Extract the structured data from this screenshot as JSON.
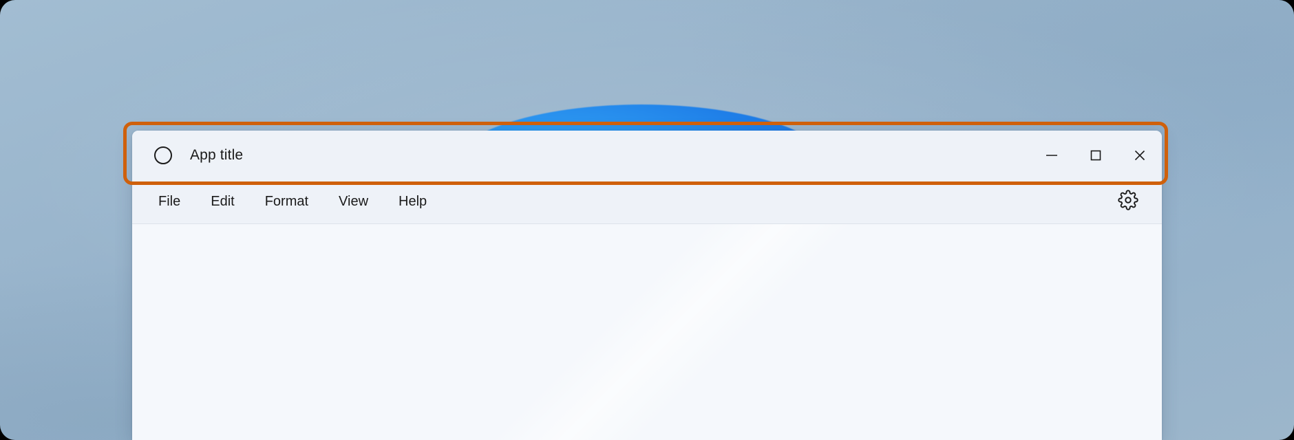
{
  "desktop": {
    "wallpaper_name": "windows-bloom-wallpaper",
    "background_color": "#97b3cb",
    "bloom_colors": [
      "#5fc4fb",
      "#35a7f6",
      "#1f7fe8",
      "#1a63d6"
    ]
  },
  "annotation": {
    "name": "title-bar-highlight",
    "color": "#cf600b",
    "target": "titlebar"
  },
  "window": {
    "titlebar": {
      "app_icon": "circle-icon",
      "title": "App title",
      "controls": [
        {
          "name": "minimize-button",
          "icon": "minimize-icon",
          "label": "Minimize"
        },
        {
          "name": "maximize-button",
          "icon": "maximize-icon",
          "label": "Maximize"
        },
        {
          "name": "close-button",
          "icon": "close-icon",
          "label": "Close"
        }
      ]
    },
    "menubar": {
      "items": [
        {
          "name": "menu-item-file",
          "label": "File"
        },
        {
          "name": "menu-item-edit",
          "label": "Edit"
        },
        {
          "name": "menu-item-format",
          "label": "Format"
        },
        {
          "name": "menu-item-view",
          "label": "View"
        },
        {
          "name": "menu-item-help",
          "label": "Help"
        }
      ],
      "settings": {
        "name": "settings-button",
        "icon": "gear-icon",
        "label": "Settings"
      }
    },
    "content": {
      "text": "",
      "background_color": "#f5f8fc"
    }
  }
}
